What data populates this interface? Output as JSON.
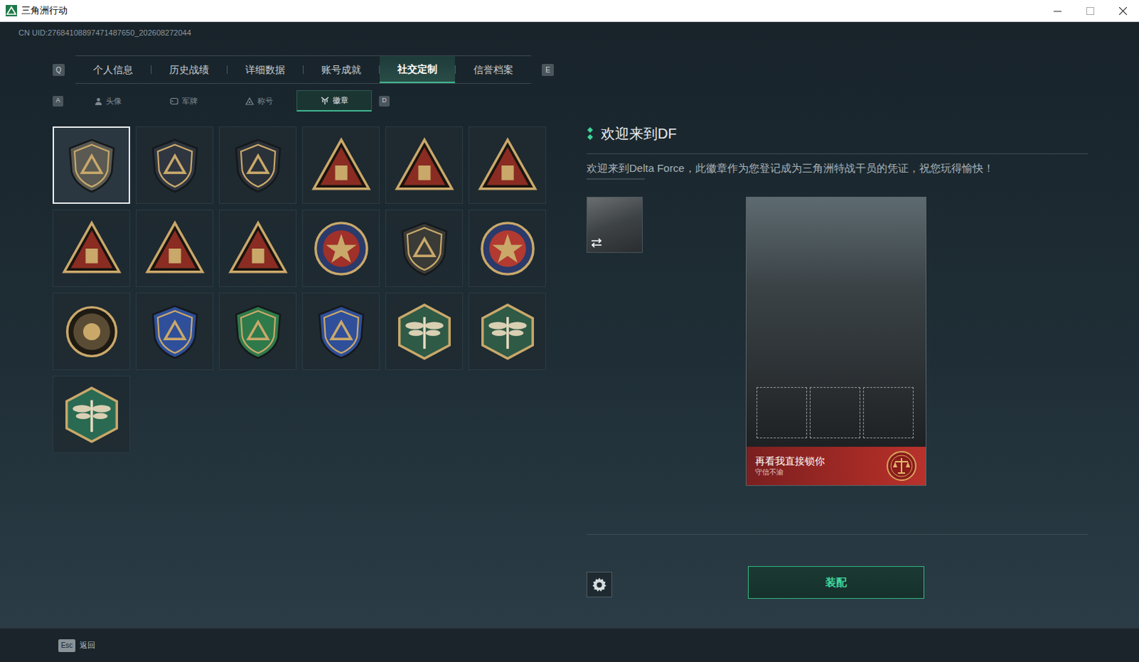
{
  "window": {
    "title": "三角洲行动"
  },
  "uid": "CN UID:27684108897471487650_202608272044",
  "tabs": {
    "prev_key": "Q",
    "next_key": "E",
    "items": [
      {
        "label": "个人信息",
        "selected": false
      },
      {
        "label": "历史战绩",
        "selected": false
      },
      {
        "label": "详细数据",
        "selected": false
      },
      {
        "label": "账号成就",
        "selected": false
      },
      {
        "label": "社交定制",
        "selected": true
      },
      {
        "label": "信誉档案",
        "selected": false
      }
    ]
  },
  "subtabs": {
    "prev_key": "A",
    "next_key": "D",
    "items": [
      {
        "label": "头像",
        "kind": "person",
        "selected": false
      },
      {
        "label": "军牌",
        "kind": "dogtag",
        "selected": false
      },
      {
        "label": "称号",
        "kind": "title",
        "selected": false
      },
      {
        "label": "徽章",
        "kind": "badge",
        "selected": true
      }
    ]
  },
  "badges": [
    {
      "kind": "shield",
      "color": "#5a5a52",
      "selected": true
    },
    {
      "kind": "shield",
      "color": "#2f3640",
      "selected": false
    },
    {
      "kind": "shield",
      "color": "#2b3138",
      "selected": false
    },
    {
      "kind": "triangle",
      "color": "#8a2c22",
      "selected": false
    },
    {
      "kind": "triangle",
      "color": "#8a2c22",
      "selected": false
    },
    {
      "kind": "triangle",
      "color": "#8a2c22",
      "selected": false
    },
    {
      "kind": "triangle",
      "color": "#8a2c22",
      "selected": false
    },
    {
      "kind": "triangle",
      "color": "#8a2c22",
      "selected": false
    },
    {
      "kind": "triangle",
      "color": "#8a2c22",
      "selected": false
    },
    {
      "kind": "emblem",
      "color": "#a0302a",
      "selected": false
    },
    {
      "kind": "shield",
      "color": "#3a3a36",
      "selected": false
    },
    {
      "kind": "emblem",
      "color": "#b23a30",
      "selected": false
    },
    {
      "kind": "round",
      "color": "#5a4c34",
      "selected": false
    },
    {
      "kind": "shield",
      "color": "#2f4f9a",
      "selected": false
    },
    {
      "kind": "shield",
      "color": "#2e7a4a",
      "selected": false
    },
    {
      "kind": "shield",
      "color": "#2f4f9a",
      "selected": false
    },
    {
      "kind": "hex",
      "color": "#2f5a46",
      "selected": false
    },
    {
      "kind": "hex",
      "color": "#2f5a46",
      "selected": false
    },
    {
      "kind": "hex",
      "color": "#2a6a52",
      "selected": false
    }
  ],
  "detail": {
    "title": "欢迎来到DF",
    "description": "欢迎来到Delta Force，此徽章作为您登记成为三角洲特战干员的凭证，祝您玩得愉快！"
  },
  "card": {
    "name_line": "再看我直接锁你",
    "subtitle": "守信不渝"
  },
  "equip_button": "装配",
  "footer": {
    "key": "Esc",
    "label": "返回"
  }
}
